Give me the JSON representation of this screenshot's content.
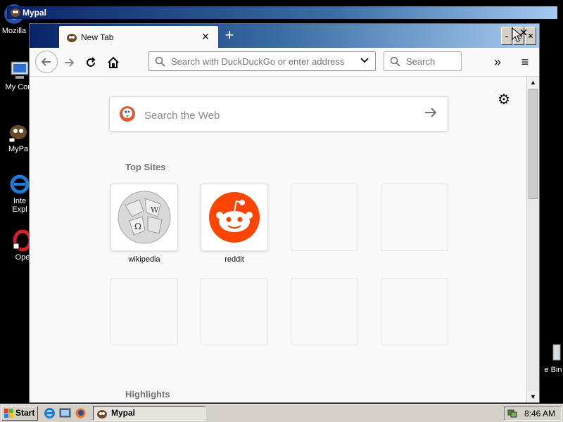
{
  "outer_window": {
    "title": "Mypal"
  },
  "desktop_icons": [
    {
      "label": "Mozilla"
    },
    {
      "label": "My Com"
    },
    {
      "label": "MyPa"
    },
    {
      "label": "Inte\nExpl"
    },
    {
      "label": "Ope"
    },
    {
      "label": "e Bin"
    }
  ],
  "browser": {
    "tab": {
      "title": "New Tab"
    },
    "window_buttons": {
      "minimize": "-",
      "maximize": "□",
      "close": "×"
    },
    "urlbar": {
      "placeholder": "Search with DuckDuckGo or enter address"
    },
    "searchbar": {
      "placeholder": "Search"
    },
    "newtab": {
      "web_search": {
        "placeholder": "Search the Web"
      },
      "top_sites_title": "Top Sites",
      "top_sites": [
        {
          "label": "wikipedia"
        },
        {
          "label": "reddit"
        },
        {
          "label": ""
        },
        {
          "label": ""
        },
        {
          "label": ""
        },
        {
          "label": ""
        },
        {
          "label": ""
        },
        {
          "label": ""
        }
      ],
      "highlights_title": "Highlights"
    }
  },
  "taskbar": {
    "start_label": "Start",
    "task_label": "Mypal",
    "clock": "8:46 AM"
  },
  "colors": {
    "titlebar_start": "#0a246a",
    "titlebar_end": "#a6caf0",
    "reddit": "#ff4500",
    "ddg": "#de5833"
  }
}
